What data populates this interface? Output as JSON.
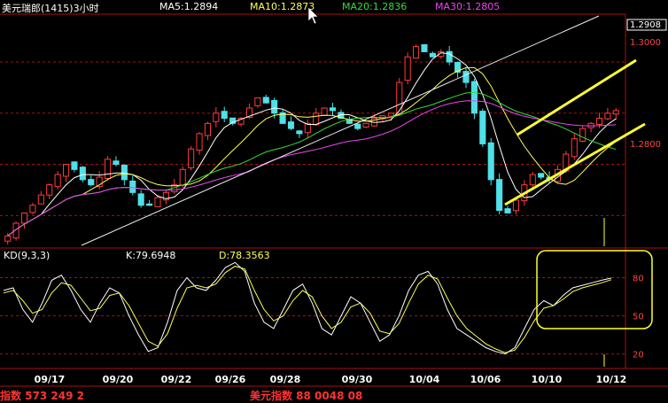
{
  "header": {
    "title": "美元瑞郎(1415)3小时",
    "ma5": "MA5:1.2894",
    "ma10": "MA10:1.2873",
    "ma20": "MA20:1.2836",
    "ma30": "MA30:1.2805"
  },
  "kd_header": {
    "name": "KD(9,3,3)",
    "k": "K:79.6948",
    "d": "D:78.3563"
  },
  "bottom_strip": {
    "left": "指数 573 249 2",
    "right": "美元指数 88 0048 08"
  },
  "colors": {
    "candle_up": "#ff3b3b",
    "candle_down": "#4fe0e8",
    "ma5": "#ffffff",
    "ma10": "#ffff55",
    "ma20": "#33dd33",
    "ma30": "#ee44ee",
    "grid": "#aa1111",
    "highlight": "#ffff33"
  },
  "chart_data": [
    {
      "type": "candlestick",
      "title": "美元瑞郎(1415)3小时",
      "x_tick_labels": [
        "09/17",
        "09/20",
        "09/22",
        "09/26",
        "09/28",
        "09/30",
        "10/04",
        "10/06",
        "10/10",
        "10/12"
      ],
      "y_tick_labels": [
        "1.2908",
        "1.3000",
        "1.2800"
      ],
      "ylim": [
        1.264,
        1.309
      ],
      "y_grid_levels": [
        1.3,
        1.29,
        1.28,
        1.27
      ],
      "current_price_marker": 1.2908,
      "series": [
        {
          "name": "MA5:1.2894",
          "last": 1.2894
        },
        {
          "name": "MA10:1.2873",
          "last": 1.2873
        },
        {
          "name": "MA20:1.2836",
          "last": 1.2836
        },
        {
          "name": "MA30:1.2805",
          "last": 1.2805
        }
      ],
      "closes": [
        1.266,
        1.2685,
        1.2705,
        1.272,
        1.274,
        1.276,
        1.278,
        1.28,
        1.279,
        1.277,
        1.276,
        1.2775,
        1.281,
        1.28,
        1.277,
        1.2745,
        1.272,
        1.272,
        1.2735,
        1.2745,
        1.276,
        1.279,
        1.283,
        1.286,
        1.288,
        1.29,
        1.289,
        1.288,
        1.289,
        1.291,
        1.293,
        1.292,
        1.29,
        1.288,
        1.287,
        1.286,
        1.288,
        1.29,
        1.291,
        1.2905,
        1.289,
        1.288,
        1.287,
        1.288,
        1.289,
        1.2895,
        1.29,
        1.296,
        1.301,
        1.303,
        1.302,
        1.301,
        1.302,
        1.3,
        1.298,
        1.296,
        1.29,
        1.284,
        1.277,
        1.271,
        1.2705,
        1.273,
        1.276,
        1.278,
        1.2775,
        1.277,
        1.279,
        1.282,
        1.285,
        1.287,
        1.288,
        1.289,
        1.29,
        1.2905
      ],
      "channel_upper": [
        [
          1.282,
          1.2955
        ]
      ],
      "channel_lower": [
        [
          1.27,
          1.2845
        ]
      ],
      "trendline_long": [
        [
          1.265,
          1.306
        ]
      ]
    },
    {
      "type": "line",
      "title": "KD(9,3,3)",
      "y_tick_labels": [
        "80",
        "50",
        "20"
      ],
      "ylim": [
        10,
        95
      ],
      "series": [
        {
          "name": "K:79.6948",
          "last": 79.6948,
          "values": [
            70,
            72,
            55,
            45,
            60,
            78,
            82,
            70,
            55,
            45,
            60,
            72,
            68,
            50,
            35,
            22,
            25,
            45,
            70,
            80,
            72,
            70,
            78,
            88,
            92,
            85,
            60,
            45,
            40,
            55,
            70,
            75,
            60,
            40,
            35,
            50,
            65,
            60,
            45,
            30,
            35,
            50,
            70,
            82,
            85,
            75,
            55,
            40,
            35,
            30,
            25,
            22,
            20,
            25,
            40,
            55,
            62,
            58,
            66,
            72,
            74,
            76,
            78,
            79.7
          ]
        },
        {
          "name": "D:78.3563",
          "last": 78.3563,
          "values": [
            68,
            70,
            62,
            52,
            55,
            68,
            76,
            74,
            64,
            54,
            56,
            66,
            68,
            58,
            44,
            30,
            26,
            36,
            56,
            72,
            74,
            72,
            75,
            84,
            89,
            87,
            70,
            55,
            46,
            50,
            62,
            70,
            65,
            50,
            40,
            45,
            57,
            60,
            52,
            38,
            36,
            44,
            60,
            75,
            82,
            79,
            64,
            50,
            40,
            34,
            28,
            24,
            21,
            23,
            33,
            46,
            56,
            58,
            63,
            69,
            72,
            74,
            76,
            78.4
          ]
        }
      ]
    }
  ]
}
